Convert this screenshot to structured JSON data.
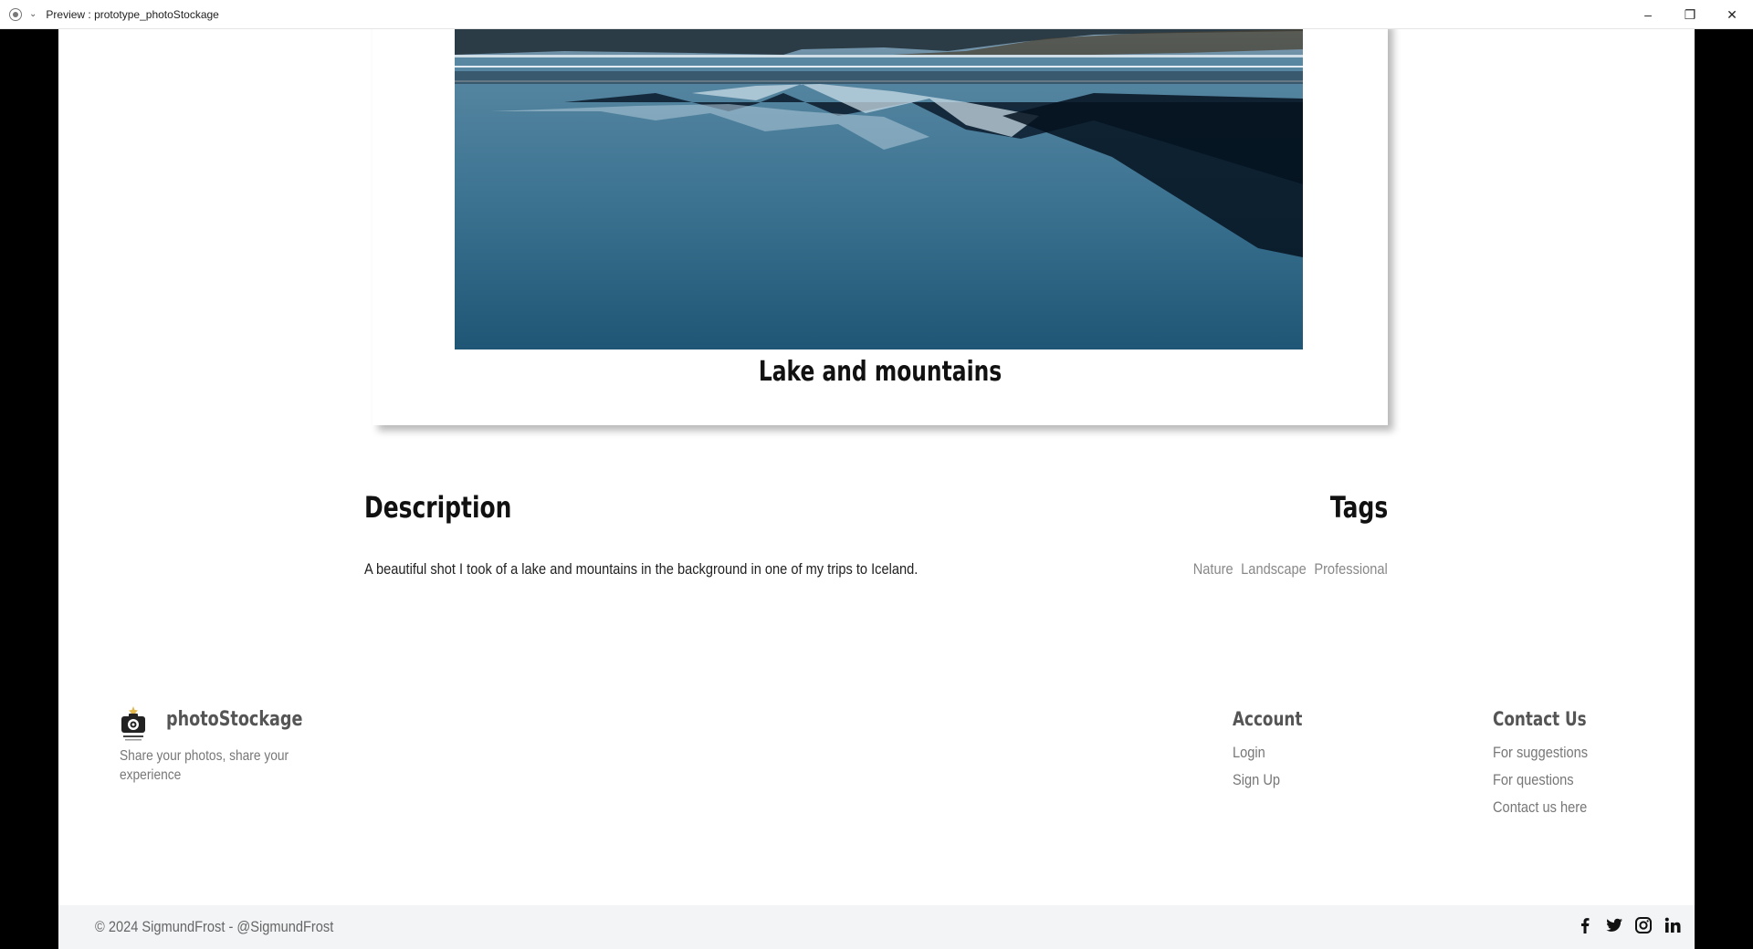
{
  "window": {
    "title": "Preview : prototype_photoStockage",
    "controls": {
      "minimize": "–",
      "restore": "❐",
      "close": "✕"
    }
  },
  "photo": {
    "caption": "Lake and mountains"
  },
  "description": {
    "heading": "Description",
    "text": "A beautiful shot I took of a lake and mountains in the background in one of my trips to Iceland."
  },
  "tags": {
    "heading": "Tags",
    "items": [
      "Nature",
      "Landscape",
      "Professional"
    ]
  },
  "footer": {
    "brand": "photoStockage",
    "tagline": "Share your photos, share your experience",
    "account": {
      "title": "Account",
      "links": [
        "Login",
        "Sign Up"
      ]
    },
    "contact": {
      "title": "Contact Us",
      "links": [
        "For suggestions",
        "For questions",
        "Contact us here"
      ]
    },
    "copyright": "© 2024 SigmundFrost - @SigmundFrost",
    "socials": [
      "facebook-icon",
      "twitter-icon",
      "instagram-icon",
      "linkedin-icon"
    ]
  },
  "colors": {
    "page_bg": "#ffffff",
    "outer_bg": "#000000",
    "footer_bottom_bg": "#f3f4f6",
    "heading": "#111111",
    "muted": "#777777"
  }
}
